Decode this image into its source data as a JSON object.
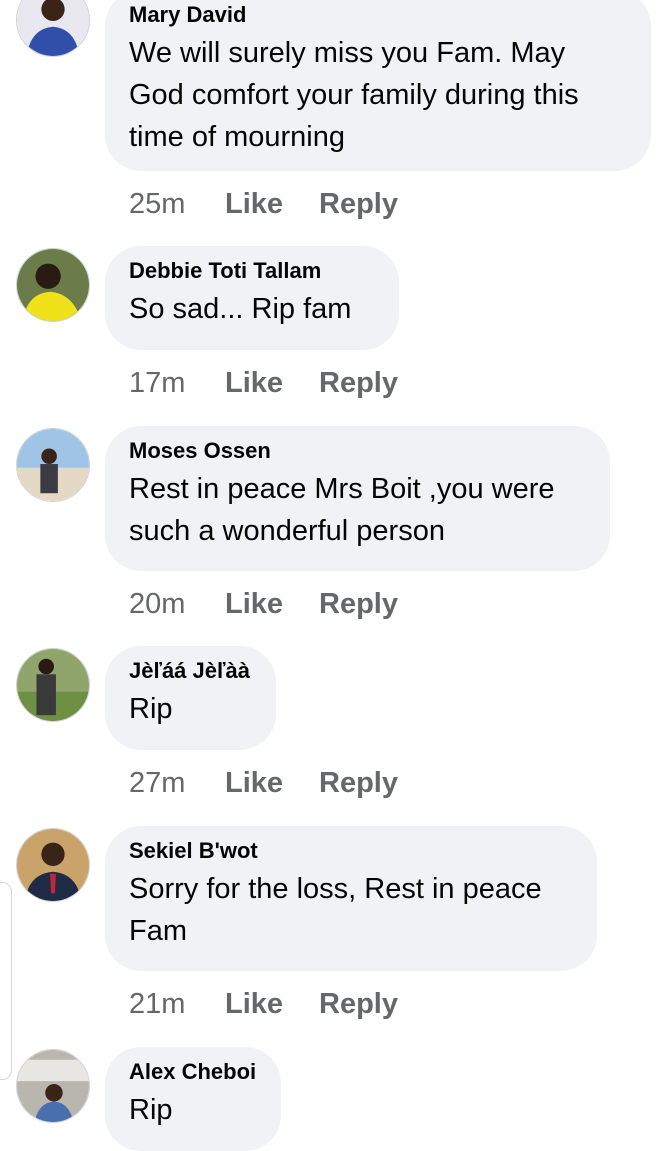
{
  "comments": [
    {
      "author": "Mary David",
      "text": "We will surely miss you Fam. May God comfort your family during this time of mourning",
      "time": "25m",
      "like": "Like",
      "reply": "Reply",
      "avatar_icon": "profile-photo-woman-blue-top"
    },
    {
      "author": "Debbie Toti Tallam",
      "text": "So sad... Rip fam",
      "time": "17m",
      "like": "Like",
      "reply": "Reply",
      "avatar_icon": "profile-photo-woman-yellow-top"
    },
    {
      "author": "Moses Ossen",
      "text": "Rest in peace Mrs Boit ,you were such a wonderful person",
      "time": "20m",
      "like": "Like",
      "reply": "Reply",
      "avatar_icon": "profile-photo-man-beach"
    },
    {
      "author": "Jèľáá Jèľàà",
      "text": "Rip",
      "time": "27m",
      "like": "Like",
      "reply": "Reply",
      "avatar_icon": "profile-photo-man-outdoors"
    },
    {
      "author": "Sekiel B'wot",
      "text": "Sorry for the loss, Rest in peace Fam",
      "time": "21m",
      "like": "Like",
      "reply": "Reply",
      "avatar_icon": "profile-photo-man-suit"
    },
    {
      "author": "Alex Cheboi",
      "text": "Rip",
      "avatar_icon": "profile-photo-man-indoors"
    }
  ],
  "colors": {
    "bubble": "#f0f2f5",
    "meta": "#65676b",
    "text": "#050505"
  }
}
